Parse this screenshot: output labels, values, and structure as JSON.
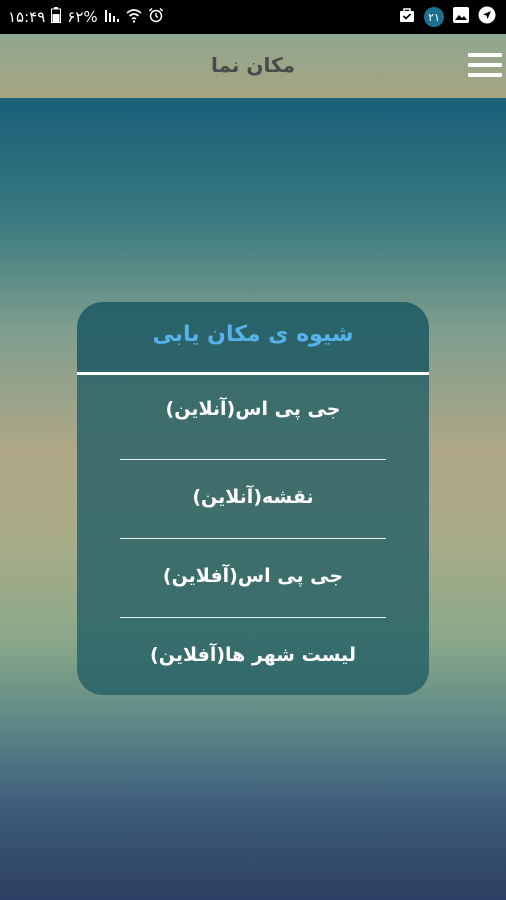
{
  "status_bar": {
    "time": "۱۵:۴۹",
    "battery": "۶۲%",
    "notification_count": "۲۱"
  },
  "app_bar": {
    "title": "مکان نما",
    "menu_icon": "hamburger-menu-icon"
  },
  "dialog": {
    "title": "شیوه ی مکان یابی",
    "options": [
      "جی پی اس(آنلاین)",
      "نقشه(آنلاین)",
      "جی پی اس(آفلاین)",
      "لیست شهر ها(آفلاین)"
    ]
  },
  "colors": {
    "dialog_title": "#55b3ea",
    "app_title": "#4a4a4a",
    "status_badge": "#1d6f8f"
  }
}
